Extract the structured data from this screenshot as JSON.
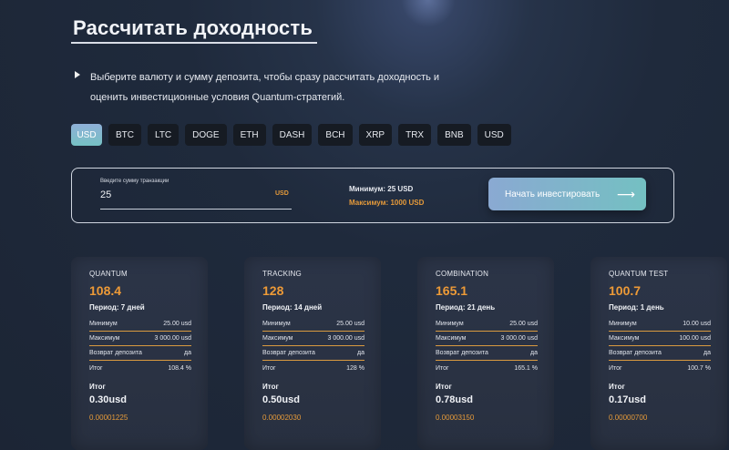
{
  "header": {
    "title": "Рассчитать доходность",
    "description_line1": "Выберите валюту и сумму депозита, чтобы сразу рассчитать доходность и",
    "description_line2": "оценить инвестиционные условия Quantum-стратегий."
  },
  "currencies": [
    "USD",
    "BTC",
    "LTC",
    "DOGE",
    "ETH",
    "DASH",
    "BCH",
    "XRP",
    "TRX",
    "BNB",
    "USD"
  ],
  "selected_currency_index": 0,
  "calculator": {
    "input_label": "Введите сумму транзакции",
    "input_value": "25",
    "input_currency": "USD",
    "min_text": "Минимум: 25 USD",
    "max_text": "Максимум: 1000 USD",
    "invest_button": "Начать инвестировать",
    "arrow": "⟶"
  },
  "row_labels": {
    "min": "Минимум",
    "max": "Максимум",
    "return": "Возврат депозита",
    "total": "Итог",
    "total_big": "Итог"
  },
  "plans": [
    {
      "name": "QUANTUM",
      "rate": "108.4",
      "period": "Период: 7 дней",
      "min": "25.00 usd",
      "max": "3 000.00 usd",
      "return": "да",
      "total_pct": "108.4 %",
      "total_value": "0.30usd",
      "btc": "0.00001225"
    },
    {
      "name": "TRACKING",
      "rate": "128",
      "period": "Период: 14 дней",
      "min": "25.00 usd",
      "max": "3 000.00 usd",
      "return": "да",
      "total_pct": "128 %",
      "total_value": "0.50usd",
      "btc": "0.00002030"
    },
    {
      "name": "COMBINATION",
      "rate": "165.1",
      "period": "Период: 21 день",
      "min": "25.00 usd",
      "max": "3 000.00 usd",
      "return": "да",
      "total_pct": "165.1 %",
      "total_value": "0.78usd",
      "btc": "0.00003150"
    },
    {
      "name": "QUANTUM TEST",
      "rate": "100.7",
      "period": "Период: 1 день",
      "min": "10.00 usd",
      "max": "100.00 usd",
      "return": "да",
      "total_pct": "100.7 %",
      "total_value": "0.17usd",
      "btc": "0.00000700"
    }
  ],
  "colors": {
    "accent_orange": "#ED9A37",
    "active_chip_start": "#8FB0D8",
    "active_chip_end": "#76C1C4"
  }
}
